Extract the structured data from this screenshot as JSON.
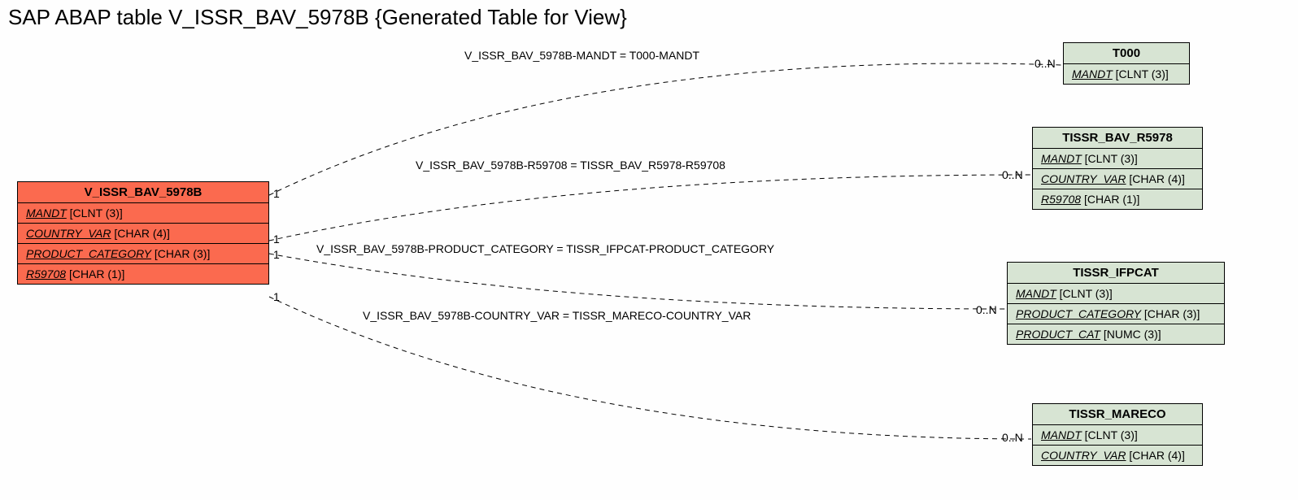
{
  "title": "SAP ABAP table V_ISSR_BAV_5978B {Generated Table for View}",
  "source": {
    "name": "V_ISSR_BAV_5978B",
    "fields": [
      {
        "name": "MANDT",
        "type": "[CLNT (3)]"
      },
      {
        "name": "COUNTRY_VAR",
        "type": "[CHAR (4)]"
      },
      {
        "name": "PRODUCT_CATEGORY",
        "type": "[CHAR (3)]"
      },
      {
        "name": "R59708",
        "type": "[CHAR (1)]"
      }
    ]
  },
  "targets": [
    {
      "name": "T000",
      "fields": [
        {
          "name": "MANDT",
          "type": "[CLNT (3)]"
        }
      ]
    },
    {
      "name": "TISSR_BAV_R5978",
      "fields": [
        {
          "name": "MANDT",
          "type": "[CLNT (3)]"
        },
        {
          "name": "COUNTRY_VAR",
          "type": "[CHAR (4)]"
        },
        {
          "name": "R59708",
          "type": "[CHAR (1)]"
        }
      ]
    },
    {
      "name": "TISSR_IFPCAT",
      "fields": [
        {
          "name": "MANDT",
          "type": "[CLNT (3)]"
        },
        {
          "name": "PRODUCT_CATEGORY",
          "type": "[CHAR (3)]"
        },
        {
          "name": "PRODUCT_CAT",
          "type": "[NUMC (3)]"
        }
      ]
    },
    {
      "name": "TISSR_MARECO",
      "fields": [
        {
          "name": "MANDT",
          "type": "[CLNT (3)]"
        },
        {
          "name": "COUNTRY_VAR",
          "type": "[CHAR (4)]"
        }
      ]
    }
  ],
  "relations": [
    {
      "label": "V_ISSR_BAV_5978B-MANDT = T000-MANDT",
      "left": "1",
      "right": "0..N"
    },
    {
      "label": "V_ISSR_BAV_5978B-R59708 = TISSR_BAV_R5978-R59708",
      "left": "1",
      "right": "0..N"
    },
    {
      "label": "V_ISSR_BAV_5978B-PRODUCT_CATEGORY = TISSR_IFPCAT-PRODUCT_CATEGORY",
      "left": "1",
      "right": "0..N"
    },
    {
      "label": "V_ISSR_BAV_5978B-COUNTRY_VAR = TISSR_MARECO-COUNTRY_VAR",
      "left": "1",
      "right": "0..N"
    }
  ]
}
